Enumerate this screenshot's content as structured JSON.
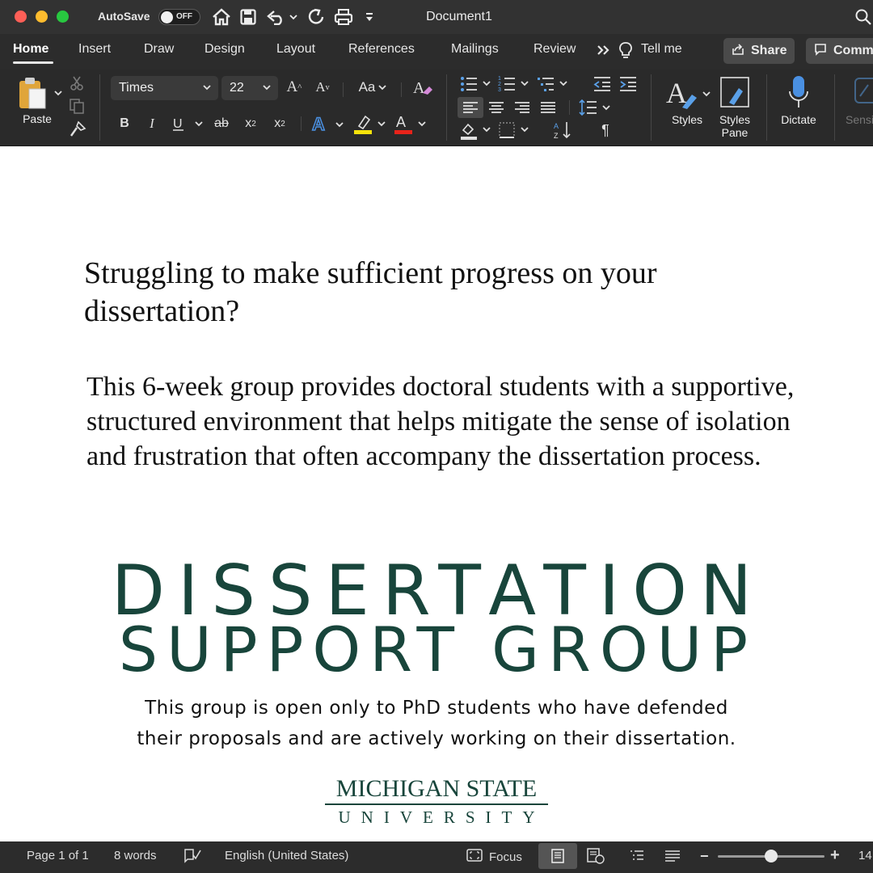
{
  "window": {
    "title": "Document1",
    "autosave_label": "AutoSave",
    "autosave_state": "OFF"
  },
  "tabs": [
    {
      "label": "Home",
      "active": true
    },
    {
      "label": "Insert"
    },
    {
      "label": "Draw"
    },
    {
      "label": "Design"
    },
    {
      "label": "Layout"
    },
    {
      "label": "References"
    },
    {
      "label": "Mailings"
    },
    {
      "label": "Review"
    }
  ],
  "tab_actions": {
    "more_icon": "double-chevron-right-icon",
    "tell_me": "Tell me",
    "share": "Share",
    "comments": "Comm"
  },
  "ribbon": {
    "paste_label": "Paste",
    "font_name": "Times",
    "font_size": "22",
    "change_case": "Aa",
    "styles_label": "Styles",
    "styles_pane_label_line1": "Styles",
    "styles_pane_label_line2": "Pane",
    "dictate_label": "Dictate",
    "sensitivity_label": "Sensi",
    "highlight_color": "#f5e20b",
    "font_color": "#e8231a"
  },
  "document": {
    "heading": "Struggling to make sufficient progress on your dissertation?",
    "body": "This 6-week group provides doctoral students with a supportive, structured environment that helps mitigate the sense of isolation and frustration that often accompany the dissertation process.",
    "flyer_title_line1": "DISSERTATION",
    "flyer_title_line2": "SUPPORT GROUP",
    "flyer_note_line1": "This group is open only to PhD students who have defended",
    "flyer_note_line2": "their proposals and are actively working on their dissertation.",
    "logo_line1": "MICHIGAN STATE",
    "logo_line2": "UNIVERSITY",
    "accent_color": "#18453b"
  },
  "statusbar": {
    "page": "Page 1 of 1",
    "words": "8 words",
    "language": "English (United States)",
    "focus": "Focus",
    "zoom_value": "14",
    "zoom_slider_fraction": 0.5
  }
}
